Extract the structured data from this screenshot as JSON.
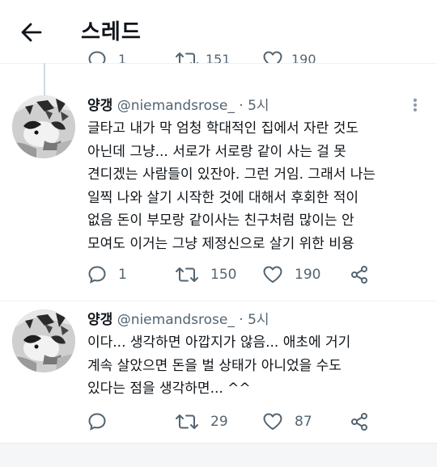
{
  "header": {
    "back_icon": "arrow-left-icon",
    "title": "스레드"
  },
  "previous_tweet_stats": {
    "reply_count": "1",
    "retweet_count": "151",
    "like_count": "190"
  },
  "tweets": [
    {
      "author_name": "양갱",
      "author_handle": "@niemandsrose_",
      "time": " · 5시",
      "lines": [
        "글타고 내가 막 엄청 학대적인 집에서 자란 것도",
        "아닌데 그냥... 서로가 서로랑 같이 사는 걸 못",
        "견디겠는 사람들이 있잔아. 그런 거임. 그래서 나는",
        "일찍 나와 살기 시작한 것에 대해서 후회한 적이",
        "없음 돈이 부모랑 같이사는 친구처럼 많이는 안",
        "모여도 이거는 그냥 제정신으로 살기 위한 비용"
      ],
      "reply_count": "1",
      "retweet_count": "150",
      "like_count": "190"
    },
    {
      "author_name": "양갱",
      "author_handle": "@niemandsrose_",
      "time": " · 5시",
      "lines": [
        "이다... 생각하면 아깝지가 않음... 애초에 거기",
        "계속 살았으면 돈을 벌 상태가 아니었을 수도",
        "있다는 점을 생각하면... ^^"
      ],
      "reply_count": "",
      "retweet_count": "29",
      "like_count": "87"
    }
  ],
  "icons": {
    "reply": "reply-icon",
    "retweet": "retweet-icon",
    "like": "heart-icon",
    "share": "share-icon",
    "more": "more-icon"
  },
  "colors": {
    "text_primary": "#0f1419",
    "text_secondary": "#536471",
    "divider": "#eff3f4",
    "thread_line": "#cfd9de"
  }
}
